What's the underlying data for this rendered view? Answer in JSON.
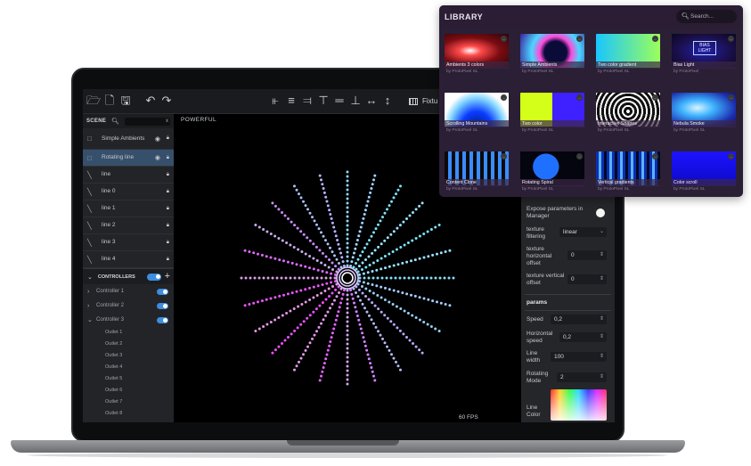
{
  "toolbar": {
    "tab_label": "Fixtu"
  },
  "scene": {
    "title": "SCENE",
    "layers": [
      {
        "label": "Simple Ambients",
        "icon": "square-icon",
        "eye": true,
        "lock": true,
        "selected": false
      },
      {
        "label": "Rotating line",
        "icon": "square-icon",
        "eye": true,
        "lock": true,
        "selected": true
      },
      {
        "label": "line",
        "icon": "line-icon",
        "eye": false,
        "lock": true,
        "selected": false
      },
      {
        "label": "line 0",
        "icon": "line-icon",
        "eye": false,
        "lock": true,
        "selected": false
      },
      {
        "label": "line 1",
        "icon": "line-icon",
        "eye": false,
        "lock": true,
        "selected": false
      },
      {
        "label": "line 2",
        "icon": "line-icon",
        "eye": false,
        "lock": true,
        "selected": false
      },
      {
        "label": "line 3",
        "icon": "line-icon",
        "eye": false,
        "lock": true,
        "selected": false
      },
      {
        "label": "line 4",
        "icon": "line-icon",
        "eye": false,
        "lock": true,
        "selected": false
      }
    ]
  },
  "controllers": {
    "title": "CONTROLLERS",
    "items": [
      {
        "label": "Controller 1",
        "expanded": false
      },
      {
        "label": "Controller 2",
        "expanded": false
      },
      {
        "label": "Controller 3",
        "expanded": true
      }
    ],
    "outlets": [
      "Outlet 1",
      "Outlet 2",
      "Outlet 3",
      "Outlet 4",
      "Outlet 5",
      "Outlet 6",
      "Outlet 7",
      "Outlet 8"
    ]
  },
  "canvas": {
    "label": "POWERFUL",
    "fps": "60 FPS"
  },
  "properties": {
    "expose_label": "Expose parameters in Manager",
    "texture_filtering_label": "texture filtering",
    "texture_filtering_value": "linear",
    "texture_h_offset_label": "texture horizontal offset",
    "texture_h_offset_value": "0",
    "texture_v_offset_label": "texture vertical offset",
    "texture_v_offset_value": "0",
    "params_heading": "params",
    "speed_label": "Speed",
    "speed_value": "0,2",
    "h_speed_label": "Horizontal speed",
    "h_speed_value": "0,2",
    "line_width_label": "Line width",
    "line_width_value": "100",
    "rotating_mode_label": "Rotating Mode",
    "rotating_mode_value": "2",
    "line_color_label": "Line Color"
  },
  "library": {
    "title": "LIBRARY",
    "search_placeholder": "Search...",
    "items": [
      {
        "title": "Ambients 3 colors",
        "author": "by ProtoPixel SL"
      },
      {
        "title": "Simple Ambients",
        "author": "by ProtoPixel SL"
      },
      {
        "title": "Two color gradient",
        "author": "by ProtoPixel SL"
      },
      {
        "title": "Bias Light",
        "author": "by ProtoPixel",
        "thumb_text": "BIAS LIGHT"
      },
      {
        "title": "Scrolling Mountains",
        "author": "by ProtoPixel SL"
      },
      {
        "title": "Two color",
        "author": "by ProtoPixel SL"
      },
      {
        "title": "Interactive Shapes",
        "author": "by ProtoPixel SL"
      },
      {
        "title": "Nebula Smoke",
        "author": "by ProtoPixel SL"
      },
      {
        "title": "Content Clone",
        "author": "by ProtoPixel SL"
      },
      {
        "title": "Rotating Spiral",
        "author": "by ProtoPixel SL"
      },
      {
        "title": "Vertical gradients",
        "author": "by ProtoPixel SL"
      },
      {
        "title": "Color scroll",
        "author": "by ProtoPixel SL"
      }
    ]
  },
  "colors": {
    "accent": "#3d8de0",
    "selected_row": "#36506c",
    "library_bg": "#2b1f35"
  }
}
